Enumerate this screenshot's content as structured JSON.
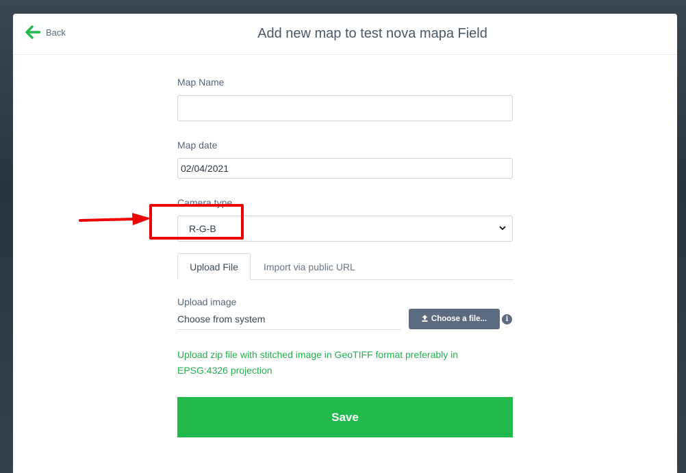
{
  "header": {
    "back_label": "Back",
    "title": "Add new map to test nova mapa Field"
  },
  "form": {
    "map_name_label": "Map Name",
    "map_name_value": "",
    "map_date_label": "Map date",
    "map_date_value": "02/04/2021",
    "camera_type_label": "Camera type",
    "camera_type_value": "R-G-B",
    "tabs": {
      "upload_file": "Upload File",
      "import_url": "Import via public URL"
    },
    "upload_image_label": "Upload image",
    "choose_from_system": "Choose from system",
    "choose_file_button": "Choose a file...",
    "hint": "Upload zip file with stitched image in GeoTIFF format preferably in EPSG:4326 projection",
    "save_label": "Save"
  },
  "colors": {
    "accent_green": "#22ba4c",
    "annotation_red": "#ee0000",
    "button_slate": "#5d6b80"
  },
  "icons": [
    "arrow-left-icon",
    "chevron-down-icon",
    "upload-icon",
    "info-icon",
    "annotation-arrow"
  ]
}
